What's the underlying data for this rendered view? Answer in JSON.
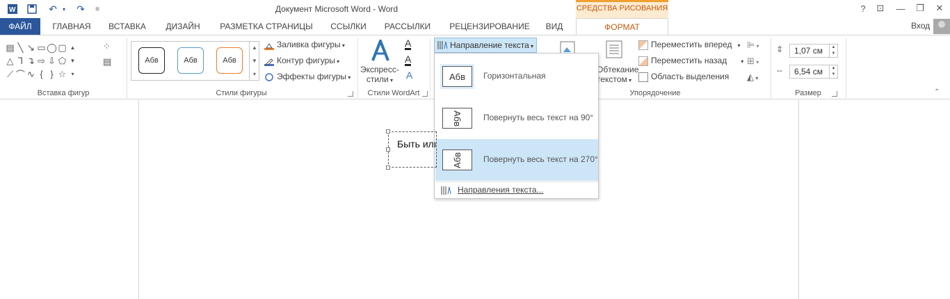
{
  "window": {
    "title": "Документ Microsoft Word - Word"
  },
  "quick_access": [
    "word-icon",
    "save-icon",
    "undo-icon",
    "redo-icon",
    "customize-icon"
  ],
  "context_tab_group": "СРЕДСТВА РИСОВАНИЯ",
  "tabs": [
    {
      "label": "ФАЙЛ"
    },
    {
      "label": "ГЛАВНАЯ"
    },
    {
      "label": "ВСТАВКА"
    },
    {
      "label": "ДИЗАЙН"
    },
    {
      "label": "РАЗМЕТКА СТРАНИЦЫ"
    },
    {
      "label": "ССЫЛКИ"
    },
    {
      "label": "РАССЫЛКИ"
    },
    {
      "label": "РЕЦЕНЗИРОВАНИЕ"
    },
    {
      "label": "ВИД"
    },
    {
      "label": "ФОРМАТ"
    }
  ],
  "account": {
    "sign_in": "Вход"
  },
  "ribbon": {
    "insert_shapes": {
      "label": "Вставка фигур"
    },
    "shape_styles": {
      "label": "Стили фигуры",
      "presets": [
        "Абв",
        "Абв",
        "Абв"
      ],
      "fill": "Заливка фигуры",
      "outline": "Контур фигуры",
      "effects": "Эффекты фигуры"
    },
    "wordart": {
      "label": "Стили WordArt",
      "express_line1": "Экспресс-",
      "express_line2": "стили"
    },
    "text": {
      "direction_button": "Направление текста"
    },
    "arrange": {
      "label": "Упорядочение",
      "wrap_line1": "Обтекание",
      "wrap_line2": "текстом",
      "bring_forward": "Переместить вперед",
      "send_backward": "Переместить назад",
      "selection_pane": "Область выделения"
    },
    "size": {
      "label": "Размер",
      "height": "1,07 см",
      "width": "6,54 см"
    }
  },
  "text_direction_menu": {
    "items": [
      {
        "thumb": "Абв",
        "label": "Горизонтальная"
      },
      {
        "thumb": "Абв",
        "label": "Повернуть весь текст на 90°"
      },
      {
        "thumb": "Абв",
        "label": "Повернуть весь текст на 270°"
      }
    ],
    "footer": "Направления текста..."
  },
  "document": {
    "textbox_text": "Быть или"
  },
  "colors": {
    "file_tab": "#2b579a",
    "accent": "#c55a11",
    "context_group": "#fcebd0",
    "hover": "#cde6f7"
  }
}
